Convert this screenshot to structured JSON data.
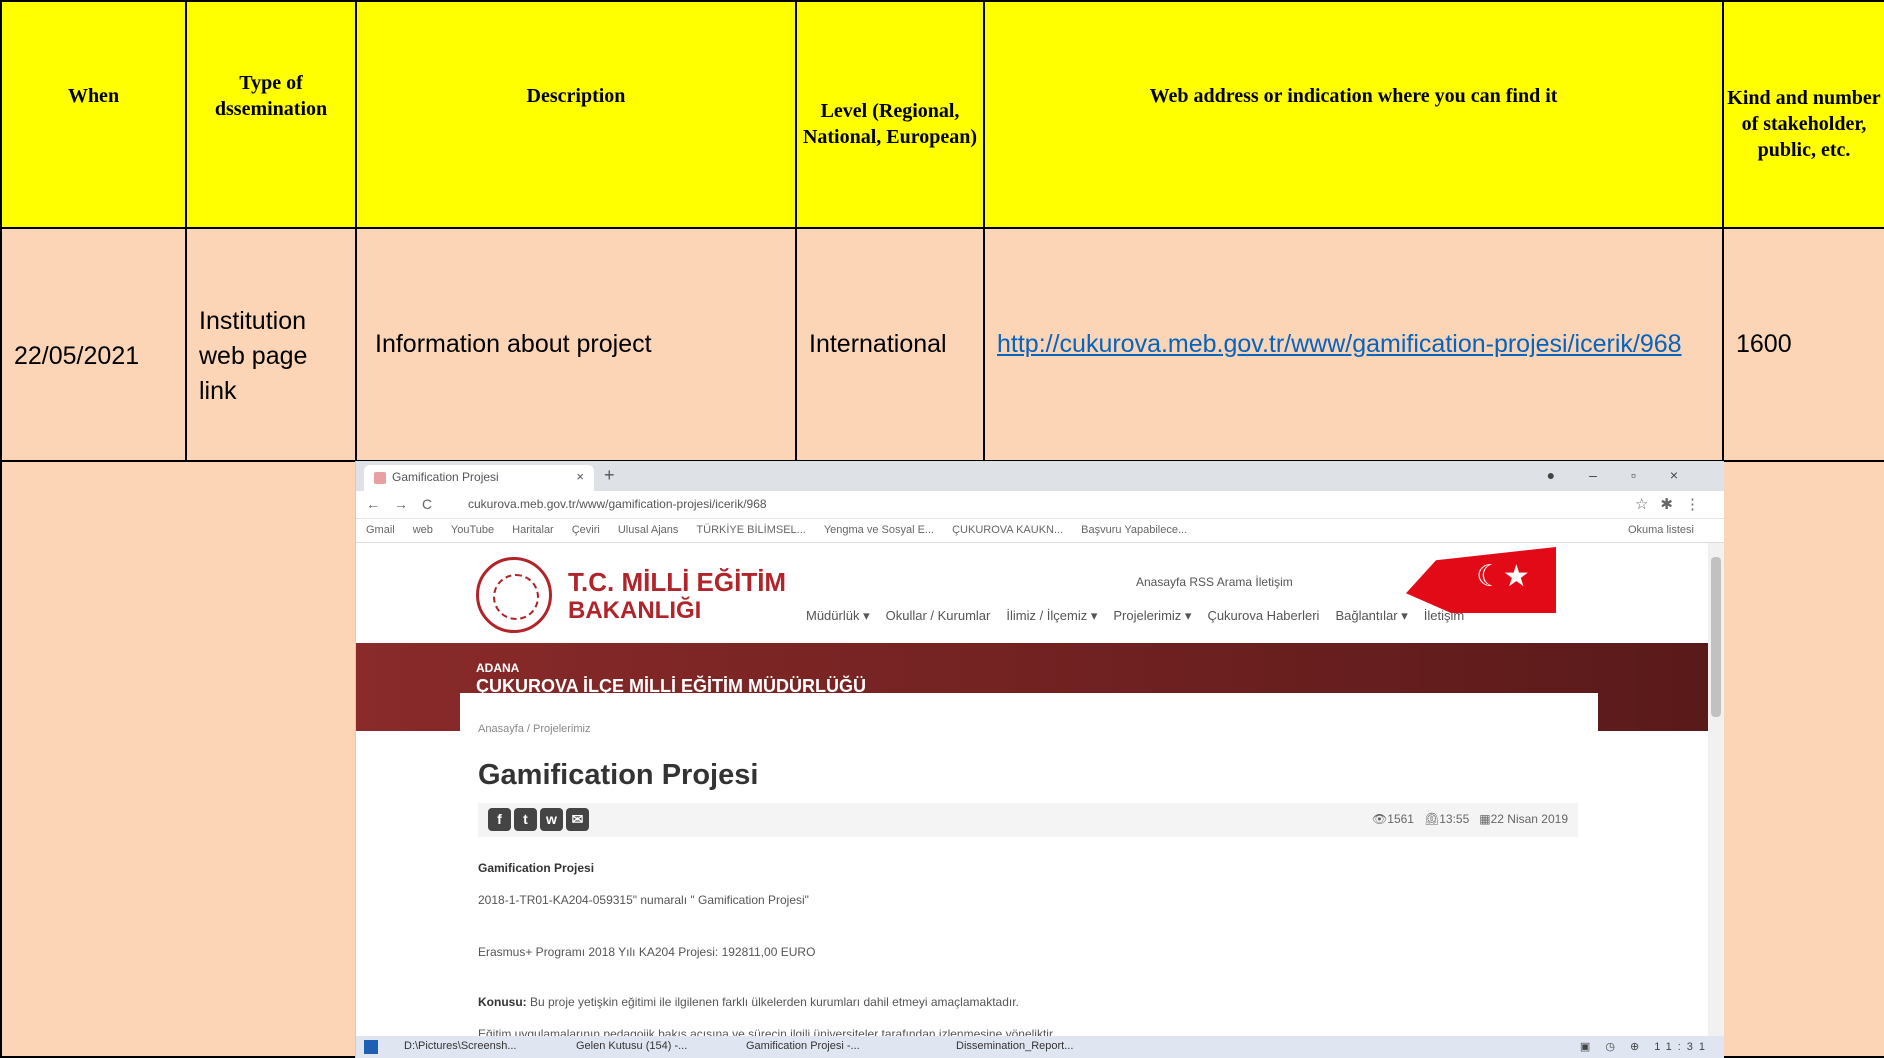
{
  "table": {
    "headers": {
      "when": "When",
      "type": "Type of dssemination",
      "description": "Description",
      "level": "Level (Regional, National, European)",
      "web": "Web address or indication where you can find it",
      "kind": "Kind and number of stakeholder, public, etc."
    },
    "row": {
      "when": "22/05/2021",
      "type": "Institution web page link",
      "description": "Information about project",
      "level": "International",
      "link": "http://cukurova.meb.gov.tr/www/gamification-projesi/icerik/968",
      "kind": "1600"
    }
  },
  "browser": {
    "tab_title": "Gamification Projesi",
    "url": "cukurova.meb.gov.tr/www/gamification-projesi/icerik/968",
    "bookmarks": [
      "Gmail",
      "web",
      "YouTube",
      "Haritalar",
      "Çeviri",
      "Ulusal Ajans",
      "TÜRKİYE BİLİMSEL...",
      "Yengma ve Sosyal E...",
      "ÇUKUROVA KAUKN...",
      "Başvuru Yapabilece..."
    ],
    "bookmarks_right": "Okuma listesi",
    "site": {
      "logo_line1": "T.C. MİLLİ EĞİTİM",
      "logo_line2": "BAKANLIĞI",
      "top_links": "Anasayfa   RSS   Arama   İletişim",
      "nav": [
        "Müdürlük ▾",
        "Okullar / Kurumlar",
        "İlimiz / İlçemiz ▾",
        "Projelerimiz ▾",
        "Çukurova Haberleri",
        "Bağlantılar ▾",
        "İletişim"
      ],
      "banner_sub": "ADANA",
      "banner_title": "ÇUKUROVA İLÇE MİLLİ EĞİTİM MÜDÜRLÜĞÜ",
      "breadcrumb": "Anasayfa / Projelerimiz",
      "page_title": "Gamification Projesi",
      "views": "1561",
      "time": "13:55",
      "date": "22 Nisan 2019",
      "para_heading": "Gamification Projesi",
      "para1": "2018-1-TR01-KA204-059315\" numaralı \" Gamification Projesi\"",
      "para2": "Erasmus+ Programı 2018 Yılı KA204 Projesi: 192811,00 EURO",
      "para3_label": "Konusu:",
      "para3": " Bu proje yetişkin eğitimi ile ilgilenen farklı ülkelerden kurumları dahil etmeyi amaçlamaktadır.",
      "para4": "Eğitim uygulamalarının pedagojik bakış açısına ve sürecin ilgili üniversiteler tarafından izlenmesine yöneliktir."
    },
    "taskbar": {
      "items": [
        "D:\\Pictures\\Screensh...",
        "Gelen Kutusu (154) -...",
        "Gamification Projesi -...",
        "Dissemination_Report..."
      ],
      "clock": "11:31"
    }
  }
}
